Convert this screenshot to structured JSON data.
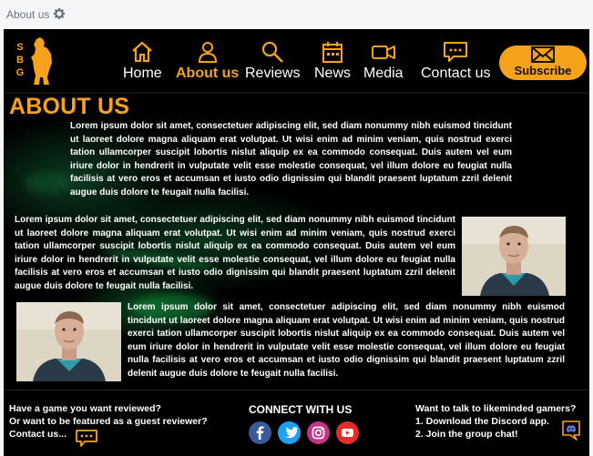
{
  "tab": {
    "label": "About us",
    "icon": "gear-icon"
  },
  "logo": {
    "letters": [
      "S",
      "B",
      "G"
    ],
    "icon": "bear-silhouette-icon"
  },
  "nav": {
    "items": [
      {
        "label": "Home",
        "icon": "home-icon",
        "active": false
      },
      {
        "label": "About us",
        "icon": "person-icon",
        "active": true
      },
      {
        "label": "Reviews",
        "icon": "search-icon",
        "active": false
      },
      {
        "label": "News",
        "icon": "calendar-icon",
        "active": false
      },
      {
        "label": "Media",
        "icon": "video-camera-icon",
        "active": false
      },
      {
        "label": "Contact us",
        "icon": "chat-bubble-icon",
        "active": false
      }
    ],
    "subscribe_label": "Subscribe",
    "subscribe_icon": "envelope-icon"
  },
  "main": {
    "title": "ABOUT US",
    "paragraphs": [
      "Lorem ipsum dolor sit amet, consectetuer adipiscing elit, sed diam nonummy nibh euismod tincidunt ut laoreet dolore magna aliquam erat volutpat. Ut wisi enim ad minim veniam, quis nostrud exerci tation ullamcorper suscipit lobortis nislut aliquip ex ea commodo consequat. Duis autem vel eum iriure dolor in hendrerit in vulputate velit esse molestie consequat, vel illum dolore eu feugiat nulla facilisis at vero eros et accumsan et iusto odio dignissim qui blandit praesent luptatum zzril delenit augue duis dolore te feugait nulla facilisi.",
      "Lorem ipsum dolor sit amet, consectetuer adipiscing elit, sed diam nonummy nibh euismod tincidunt ut laoreet dolore magna aliquam erat volutpat. Ut wisi enim ad minim veniam, quis nostrud exerci tation ullamcorper suscipit lobortis nislut aliquip ex ea commodo consequat. Duis autem vel eum iriure dolor in hendrerit in vulputate velit esse molestie consequat, vel illum dolore eu feugiat nulla facilisis at vero eros et accumsan et iusto odio dignissim qui blandit praesent luptatum zzril delenit augue duis dolore te feugait nulla facilisi.",
      "Lorem ipsum dolor sit amet, consectetuer adipiscing elit, sed diam nonummy nibh euismod tincidunt ut laoreet dolore magna aliquam erat volutpat. Ut wisi enim ad minim veniam, quis nostrud exerci tation ullamcorper suscipit lobortis nislut aliquip ex ea commodo consequat. Duis autem vel eum iriure dolor in hendrerit in vulputate velit esse molestie consequat, vel illum dolore eu feugiat nulla facilisis at vero eros et accumsan et iusto odio dignissim qui blandit praesent luptatum zzril delenit augue duis dolore te feugait nulla facilisi."
    ]
  },
  "footer": {
    "left_lines": [
      "Have a game you want reviewed?",
      "Or want to be featured as a guest reviewer?",
      "Contact us..."
    ],
    "left_icon": "chat-bubble-icon",
    "center_title": "CONNECT WITH US",
    "social": [
      {
        "name": "facebook-icon",
        "glyph": "f",
        "color": "#3b5998"
      },
      {
        "name": "twitter-icon",
        "glyph": "",
        "color": "#1da1f2"
      },
      {
        "name": "instagram-icon",
        "glyph": "",
        "color": "#c13584"
      },
      {
        "name": "youtube-icon",
        "glyph": "",
        "color": "#e52d27"
      }
    ],
    "right_lines": [
      "Want to talk to likeminded gamers?",
      "1. Download the Discord app.",
      "2. Join the group chat!"
    ],
    "right_icon": "discord-icon"
  },
  "colors": {
    "accent": "#f7a21b",
    "background": "#000000",
    "text": "#ffffff"
  }
}
